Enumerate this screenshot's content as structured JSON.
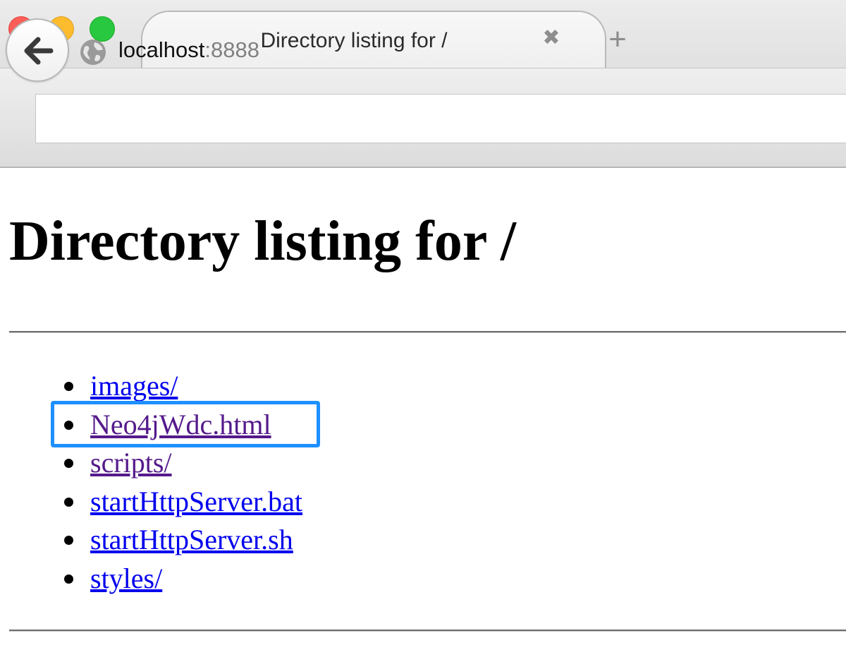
{
  "browser": {
    "tab_title": "Directory listing for /",
    "tab_close_glyph": "✖",
    "new_tab_glyph": "+",
    "url_host": "localhost",
    "url_port": ":8888",
    "icons": [
      "back-arrow-icon",
      "globe-icon",
      "close-icon",
      "plus-icon"
    ]
  },
  "page": {
    "heading": "Directory listing for /",
    "items": [
      {
        "label": "images/",
        "visited": false
      },
      {
        "label": "Neo4jWdc.html",
        "visited": true,
        "highlighted": true
      },
      {
        "label": "scripts/",
        "visited": true
      },
      {
        "label": "startHttpServer.bat",
        "visited": false
      },
      {
        "label": "startHttpServer.sh",
        "visited": false
      },
      {
        "label": "styles/",
        "visited": false
      }
    ]
  },
  "colors": {
    "link": "#0000ee",
    "visited_link": "#551a8b",
    "highlight_border": "#1e90ff",
    "traffic_close": "#fc5f57",
    "traffic_minimize": "#fdbc2e",
    "traffic_maximize": "#28c840"
  }
}
